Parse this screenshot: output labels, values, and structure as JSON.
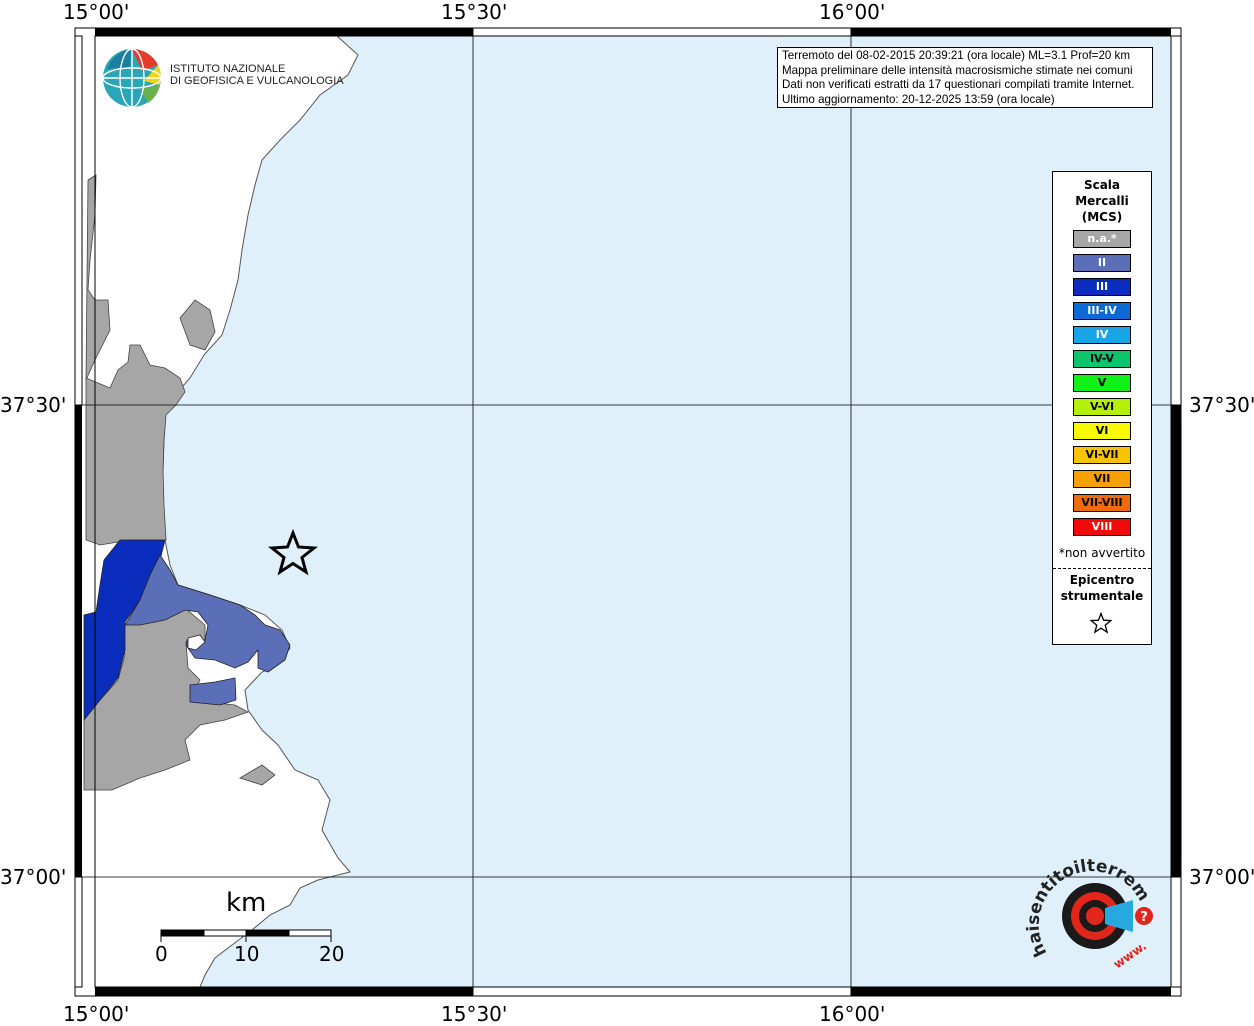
{
  "axes": {
    "top": [
      "15°00'",
      "15°30'",
      "16°00'"
    ],
    "bottom": [
      "15°00'",
      "15°30'",
      "16°00'"
    ],
    "left": [
      "37°30'",
      "37°00'"
    ],
    "right": [
      "37°30'",
      "37°00'"
    ]
  },
  "info_box": {
    "lines": [
      "Terremoto del 08-02-2015 20:39:21 (ora locale) ML=3.1 Prof=20 km",
      "Mappa preliminare delle intensità macrosismiche stimate nei comuni",
      "Dati non verificati estratti da 17 questionari compilati tramite Internet.",
      "Ultimo aggiornamento: 20-12-2025 13:59 (ora locale)"
    ]
  },
  "logo_ingv": {
    "line1": "ISTITUTO NAZIONALE",
    "line2": "DI GEOFISICA E VULCANOLOGIA"
  },
  "legend": {
    "title_lines": [
      "Scala",
      "Mercalli",
      "(MCS)"
    ],
    "items": [
      {
        "label": "n.a.*",
        "color": "#a6a6a6",
        "text_color": "#ffffff"
      },
      {
        "label": "II",
        "color": "#5b6fb8",
        "text_color": "#ffffff"
      },
      {
        "label": "III",
        "color": "#0a2dbe",
        "text_color": "#ffffff"
      },
      {
        "label": "III-IV",
        "color": "#0a69d2",
        "text_color": "#ffffff"
      },
      {
        "label": "IV",
        "color": "#1aa4e8",
        "text_color": "#ffffff"
      },
      {
        "label": "IV-V",
        "color": "#0cc46c",
        "text_color": "#000000"
      },
      {
        "label": "V",
        "color": "#12f01a",
        "text_color": "#000000"
      },
      {
        "label": "V-VI",
        "color": "#b4f00a",
        "text_color": "#000000"
      },
      {
        "label": "VI",
        "color": "#f8f800",
        "text_color": "#000000"
      },
      {
        "label": "VI-VII",
        "color": "#f8c400",
        "text_color": "#000000"
      },
      {
        "label": "VII",
        "color": "#f8a000",
        "text_color": "#000000"
      },
      {
        "label": "VII-VIII",
        "color": "#f06a0a",
        "text_color": "#000000"
      },
      {
        "label": "VIII",
        "color": "#f00a0a",
        "text_color": "#ffffff"
      }
    ],
    "note": "*non avvertito",
    "epicenter_lines": [
      "Epicentro",
      "strumentale"
    ]
  },
  "scale_bar": {
    "unit": "km",
    "labels": [
      "0",
      "10",
      "20"
    ]
  },
  "watermark": {
    "arc_text": "haisentitoilterremoto.it",
    "www": "www.",
    "mark": "?"
  },
  "colors": {
    "sea": "#dff0fb",
    "land": "#ffffff",
    "intensity_na": "#a6a6a6",
    "intensity_II": "#5b6fb8",
    "intensity_III": "#0a2dbe"
  }
}
